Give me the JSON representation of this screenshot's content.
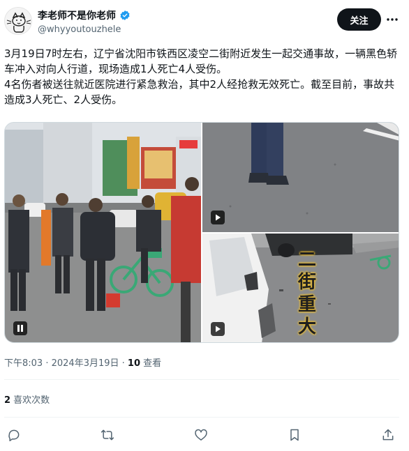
{
  "author": {
    "display_name": "李老师不是你老师",
    "handle": "@whyyoutouzhele",
    "verified_icon": "verified-badge-icon",
    "avatar_icon": "cat-avatar"
  },
  "header": {
    "follow_label": "关注",
    "more_icon": "more-dots-icon"
  },
  "post": {
    "paragraphs": [
      "3月19日7时左右，辽宁省沈阳市铁西区凌空二街附近发生一起交通事故，一辆黑色轿车冲入对向人行道，现场造成1人死亡4人受伤。",
      "4名伤者被送往就近医院进行紧急救治，其中2人经抢救无效死亡。截至目前，事故共造成3人死亡、2人受伤。"
    ]
  },
  "media": {
    "overlay_text": [
      "二",
      "街",
      "重",
      "大"
    ],
    "left_icon": "pause-icon",
    "right_icons": [
      "play-icon",
      "play-icon"
    ],
    "accent": "#1d9bf0"
  },
  "meta": {
    "time": "下午8:03",
    "separator": " · ",
    "date": "2024年3月19日",
    "views_count": "10",
    "views_label": " 查看"
  },
  "likes": {
    "count": "2",
    "label": " 喜欢次数"
  },
  "actions": {
    "icons": [
      "reply-icon",
      "repost-icon",
      "like-icon",
      "bookmark-icon",
      "share-icon"
    ]
  }
}
